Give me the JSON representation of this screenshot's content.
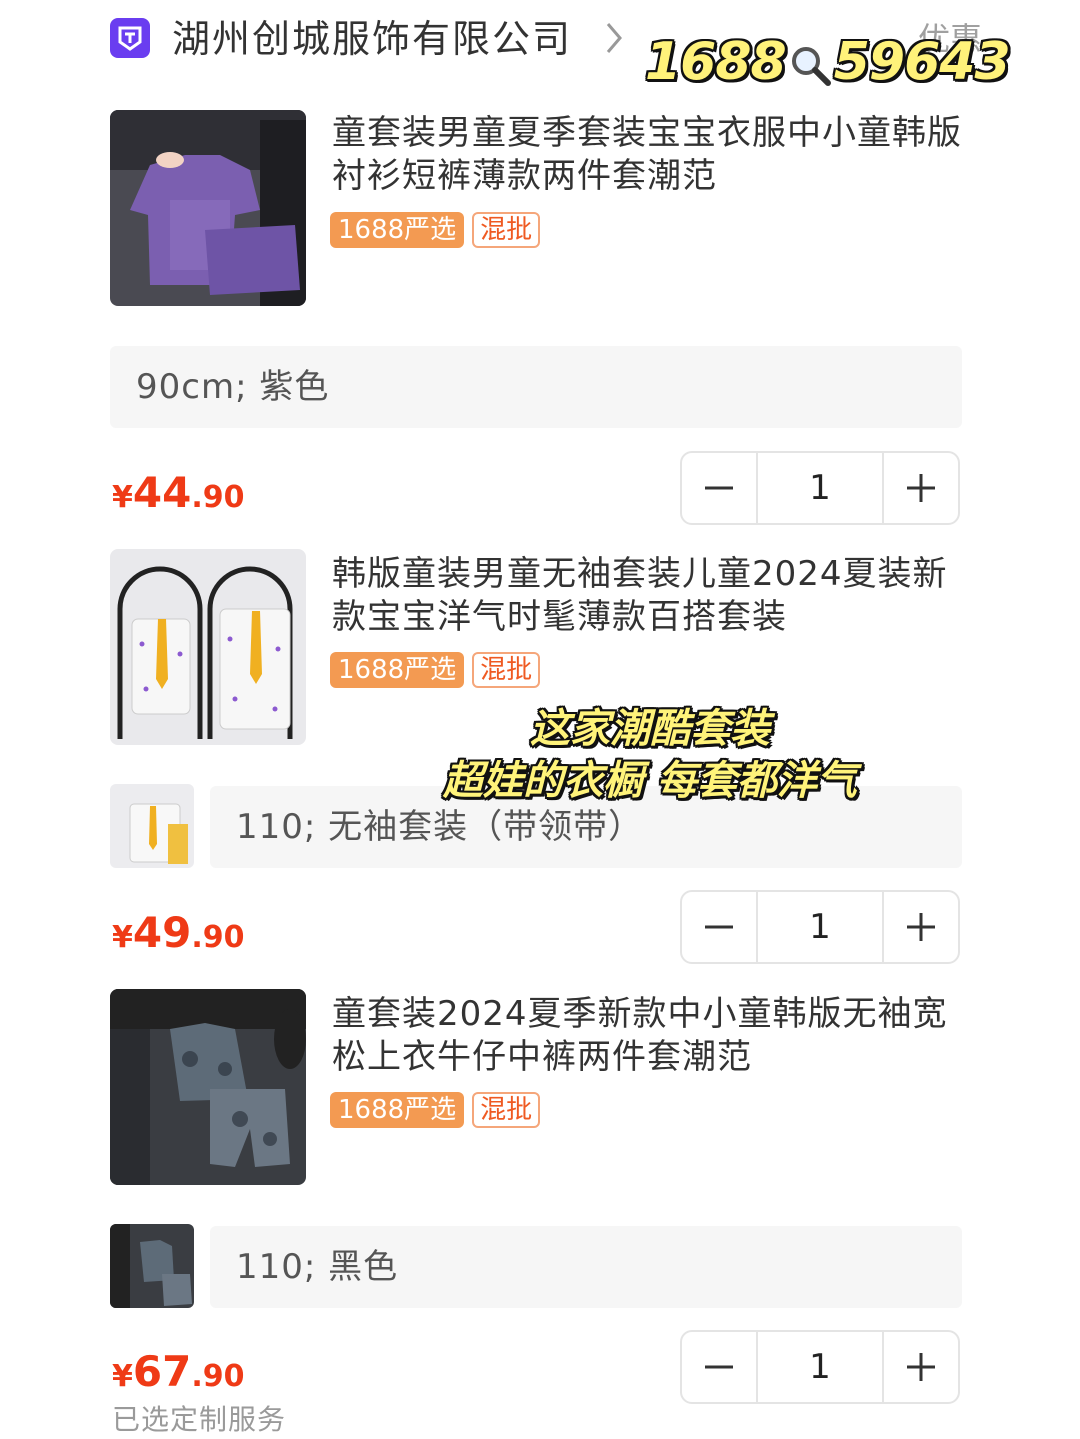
{
  "shop": {
    "name": "湖州创城服饰有限公司",
    "promo_label": "优惠",
    "brand_color": "#6a3df0"
  },
  "sticker": {
    "id_text_left": "1688",
    "id_text_right": "59643",
    "line1": "这家潮酷套装",
    "line2": "超娃的衣橱 每套都洋气"
  },
  "products": [
    {
      "title": "童套装男童夏季套装宝宝衣服中小童韩版衬衫短裤薄款两件套潮范",
      "tag_primary": "1688严选",
      "tag_secondary": "混批",
      "spec": "90cm; 紫色",
      "price_symbol": "¥",
      "price_int": "44",
      "price_dec": ".90",
      "quantity": "1",
      "image_icon": "purple-shirt-set-photo"
    },
    {
      "title": "韩版童装男童无袖套装儿童2024夏装新款宝宝洋气时髦薄款百搭套装",
      "tag_primary": "1688严选",
      "tag_secondary": "混批",
      "spec": "110; 无袖套装（带领带）",
      "price_symbol": "¥",
      "price_int": "49",
      "price_dec": ".90",
      "quantity": "1",
      "image_icon": "white-vest-tie-set-photo"
    },
    {
      "title": "童套装2024夏季新款中小童韩版无袖宽松上衣牛仔中裤两件套潮范",
      "tag_primary": "1688严选",
      "tag_secondary": "混批",
      "spec": "110; 黑色",
      "price_symbol": "¥",
      "price_int": "67",
      "price_dec": ".90",
      "quantity": "1",
      "image_icon": "denim-set-photo"
    }
  ],
  "footer": {
    "service_note": "已选定制服务"
  },
  "colors": {
    "price": "#ef3a16",
    "tag_bg": "#f39a52",
    "tag_mix": "#ef5a22",
    "spec_bg": "#f6f6f6"
  }
}
